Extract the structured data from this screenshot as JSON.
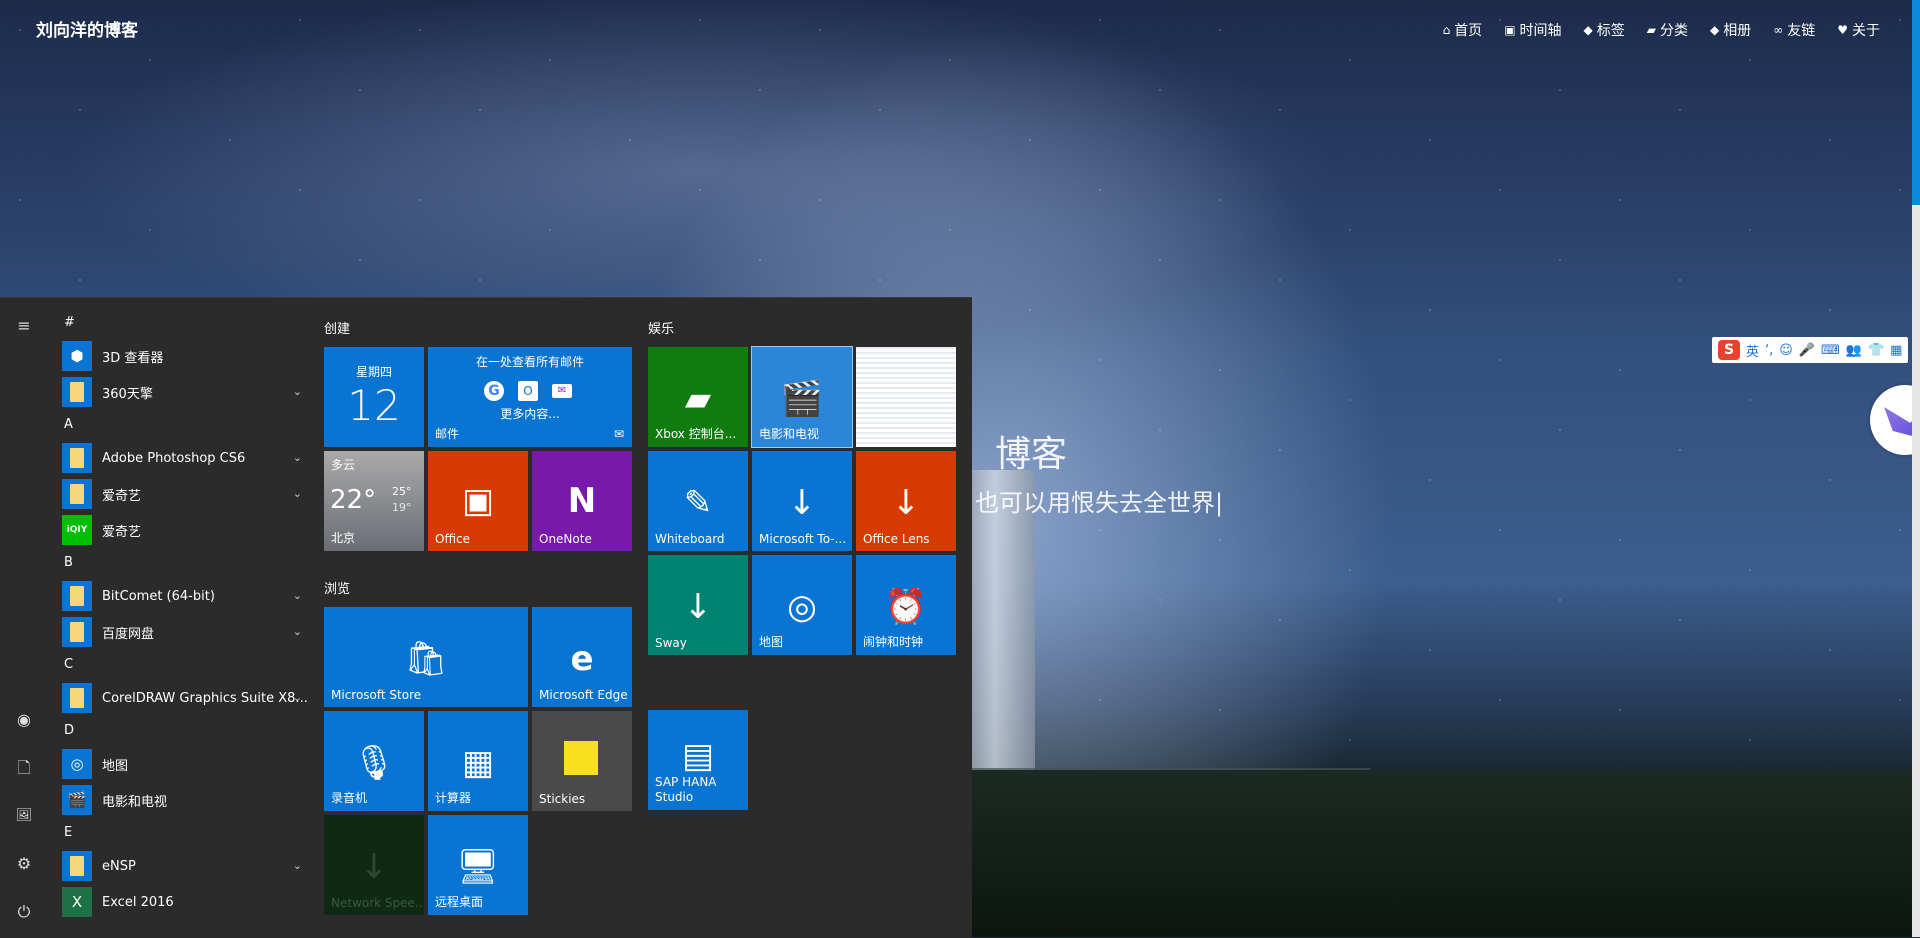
{
  "blog": {
    "title": "刘向洋的博客",
    "nav": [
      {
        "icon": "home-icon",
        "glyph": "⌂",
        "label": "首页"
      },
      {
        "icon": "archive-icon",
        "glyph": "▣",
        "label": "时间轴"
      },
      {
        "icon": "tag-icon",
        "glyph": "◆",
        "label": "标签"
      },
      {
        "icon": "folder-open-icon",
        "glyph": "▰",
        "label": "分类"
      },
      {
        "icon": "tag-icon",
        "glyph": "◆",
        "label": "相册"
      },
      {
        "icon": "link-icon",
        "glyph": "∞",
        "label": "友链"
      },
      {
        "icon": "heart-icon",
        "glyph": "♥",
        "label": "关于"
      }
    ],
    "hero_title": "博客",
    "hero_subtitle": "也可以用恨失去全世界|"
  },
  "ime": {
    "logo": "S",
    "lang": "英",
    "tools": [
      "‘,",
      "☺",
      "🎤",
      "⌨",
      "👥",
      "👕",
      "▦"
    ]
  },
  "start": {
    "rail": {
      "menu": "≡",
      "user": "◉",
      "documents": "🗋",
      "pictures": "🖼",
      "settings": "⚙",
      "power": "⏻"
    },
    "apps": [
      {
        "type": "letter",
        "text": "#"
      },
      {
        "type": "app",
        "label": "3D 查看器",
        "icon": "cube-icon",
        "glyph": "⬢",
        "expand": false
      },
      {
        "type": "app",
        "label": "360天擎",
        "icon": "folder-icon",
        "expand": true
      },
      {
        "type": "letter",
        "text": "A"
      },
      {
        "type": "app",
        "label": "Adobe Photoshop CS6",
        "icon": "folder-icon",
        "expand": true
      },
      {
        "type": "app",
        "label": "爱奇艺",
        "icon": "folder-icon",
        "expand": true
      },
      {
        "type": "app",
        "label": "爱奇艺",
        "icon": "iqiyi-icon",
        "glyph": "iQIY",
        "expand": false
      },
      {
        "type": "letter",
        "text": "B"
      },
      {
        "type": "app",
        "label": "BitComet (64-bit)",
        "icon": "folder-icon",
        "expand": true
      },
      {
        "type": "app",
        "label": "百度网盘",
        "icon": "folder-icon",
        "expand": true
      },
      {
        "type": "letter",
        "text": "C"
      },
      {
        "type": "app",
        "label": "CorelDRAW Graphics Suite X8...",
        "icon": "folder-icon",
        "expand": true
      },
      {
        "type": "letter",
        "text": "D"
      },
      {
        "type": "app",
        "label": "地图",
        "icon": "map-icon",
        "glyph": "◎",
        "expand": false
      },
      {
        "type": "app",
        "label": "电影和电视",
        "icon": "film-icon",
        "glyph": "🎬",
        "expand": false
      },
      {
        "type": "letter",
        "text": "E"
      },
      {
        "type": "app",
        "label": "eNSP",
        "icon": "folder-icon",
        "expand": true
      },
      {
        "type": "app",
        "label": "Excel 2016",
        "icon": "excel-icon",
        "glyph": "X",
        "expand": false
      }
    ],
    "groups": {
      "create": "创建",
      "play": "娱乐",
      "explore": "浏览"
    },
    "calendar": {
      "weekday": "星期四",
      "day": "12"
    },
    "mail": {
      "header": "在一处查看所有邮件",
      "more": "更多内容...",
      "label": "邮件"
    },
    "weather": {
      "condition": "多云",
      "temp": "22°",
      "high": "25°",
      "low": "19°",
      "city": "北京"
    },
    "tiles": {
      "office": "Office",
      "onenote": "OneNote",
      "xbox": "Xbox 控制台...",
      "movies": "电影和电视",
      "whiteboard": "Whiteboard",
      "todo": "Microsoft To-...",
      "lens": "Office Lens",
      "sway": "Sway",
      "maps": "地图",
      "alarms": "闹钟和时钟",
      "store": "Microsoft Store",
      "edge": "Microsoft Edge",
      "recorder": "录音机",
      "calculator": "计算器",
      "stickies": "Stickies",
      "saphana": "SAP HANA Studio",
      "netspeed": "Network Spee...",
      "remote": "远程桌面"
    },
    "colors": {
      "blue": "#0a74d2",
      "orange": "#d83b01",
      "purple": "#7719aa",
      "green": "#107c10",
      "teal": "#008272",
      "gray": "#4a4a4a"
    }
  }
}
